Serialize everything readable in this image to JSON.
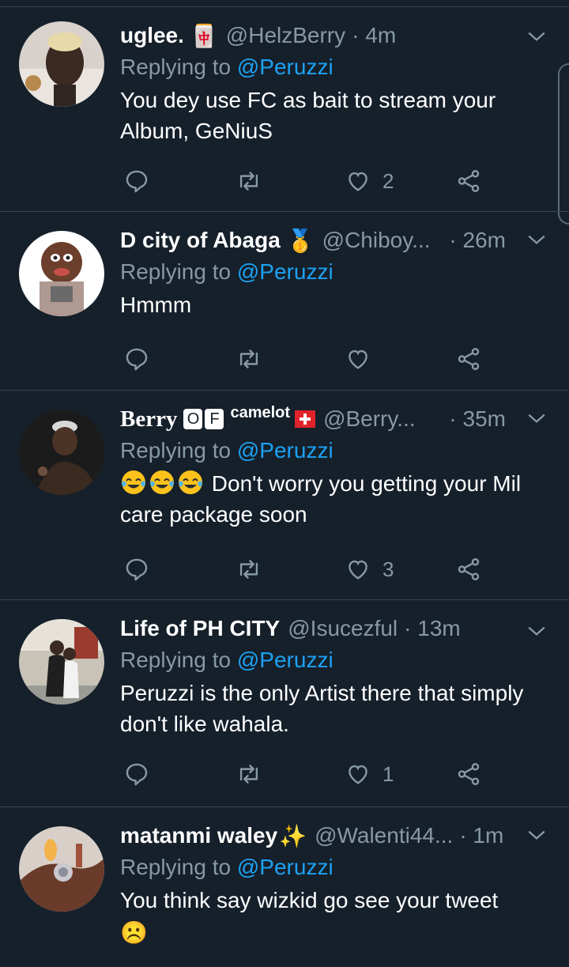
{
  "tweets": [
    {
      "name": "uglee.",
      "name_badge": "🀄",
      "handle": "@HelzBerry",
      "time": "· 4m",
      "replying_prefix": "Replying to ",
      "replying_to": "@Peruzzi",
      "text": "You dey use FC as bait to stream your Album, GeNiuS",
      "likes": "2",
      "avatar_bg": "#d9c9c0"
    },
    {
      "name": "D city of Abaga",
      "name_badge": "🥇",
      "handle": "@Chiboy...",
      "time": "· 26m",
      "replying_prefix": "Replying to ",
      "replying_to": "@Peruzzi",
      "text": "Hmmm",
      "likes": "",
      "avatar_bg": "#ffffff"
    },
    {
      "name": "Berry",
      "badge_o": "O",
      "badge_f": "F",
      "name_suffix": "camelot",
      "handle": "@Berry...",
      "time": "· 35m",
      "replying_prefix": "Replying to ",
      "replying_to": "@Peruzzi",
      "text": "Don't worry you getting your Mil care package soon",
      "likes": "3",
      "avatar_bg": "#1a1a1a"
    },
    {
      "name": "Life of PH CITY",
      "name_badge": "",
      "handle": "@Isucezful",
      "time": "· 13m",
      "replying_prefix": "Replying to ",
      "replying_to": "@Peruzzi",
      "text": "Peruzzi is the only Artist there that simply don't like wahala.",
      "likes": "1",
      "avatar_bg": "#c8c2b6"
    },
    {
      "name": "matanmi waley",
      "name_badge": "✨",
      "handle": "@Walenti44...",
      "time": "· 1m",
      "replying_prefix": "Replying to ",
      "replying_to": "@Peruzzi",
      "text": "You think say wizkid go see your tweet",
      "text_emoji": "☹️",
      "likes": "",
      "avatar_bg": "#7a4e3c"
    }
  ],
  "colors": {
    "background": "#15202b",
    "muted": "#8899a6",
    "link": "#1da1f2",
    "divider": "#38444d"
  },
  "icons": [
    "reply-icon",
    "retweet-icon",
    "like-icon",
    "share-icon",
    "chevron-down-icon"
  ]
}
